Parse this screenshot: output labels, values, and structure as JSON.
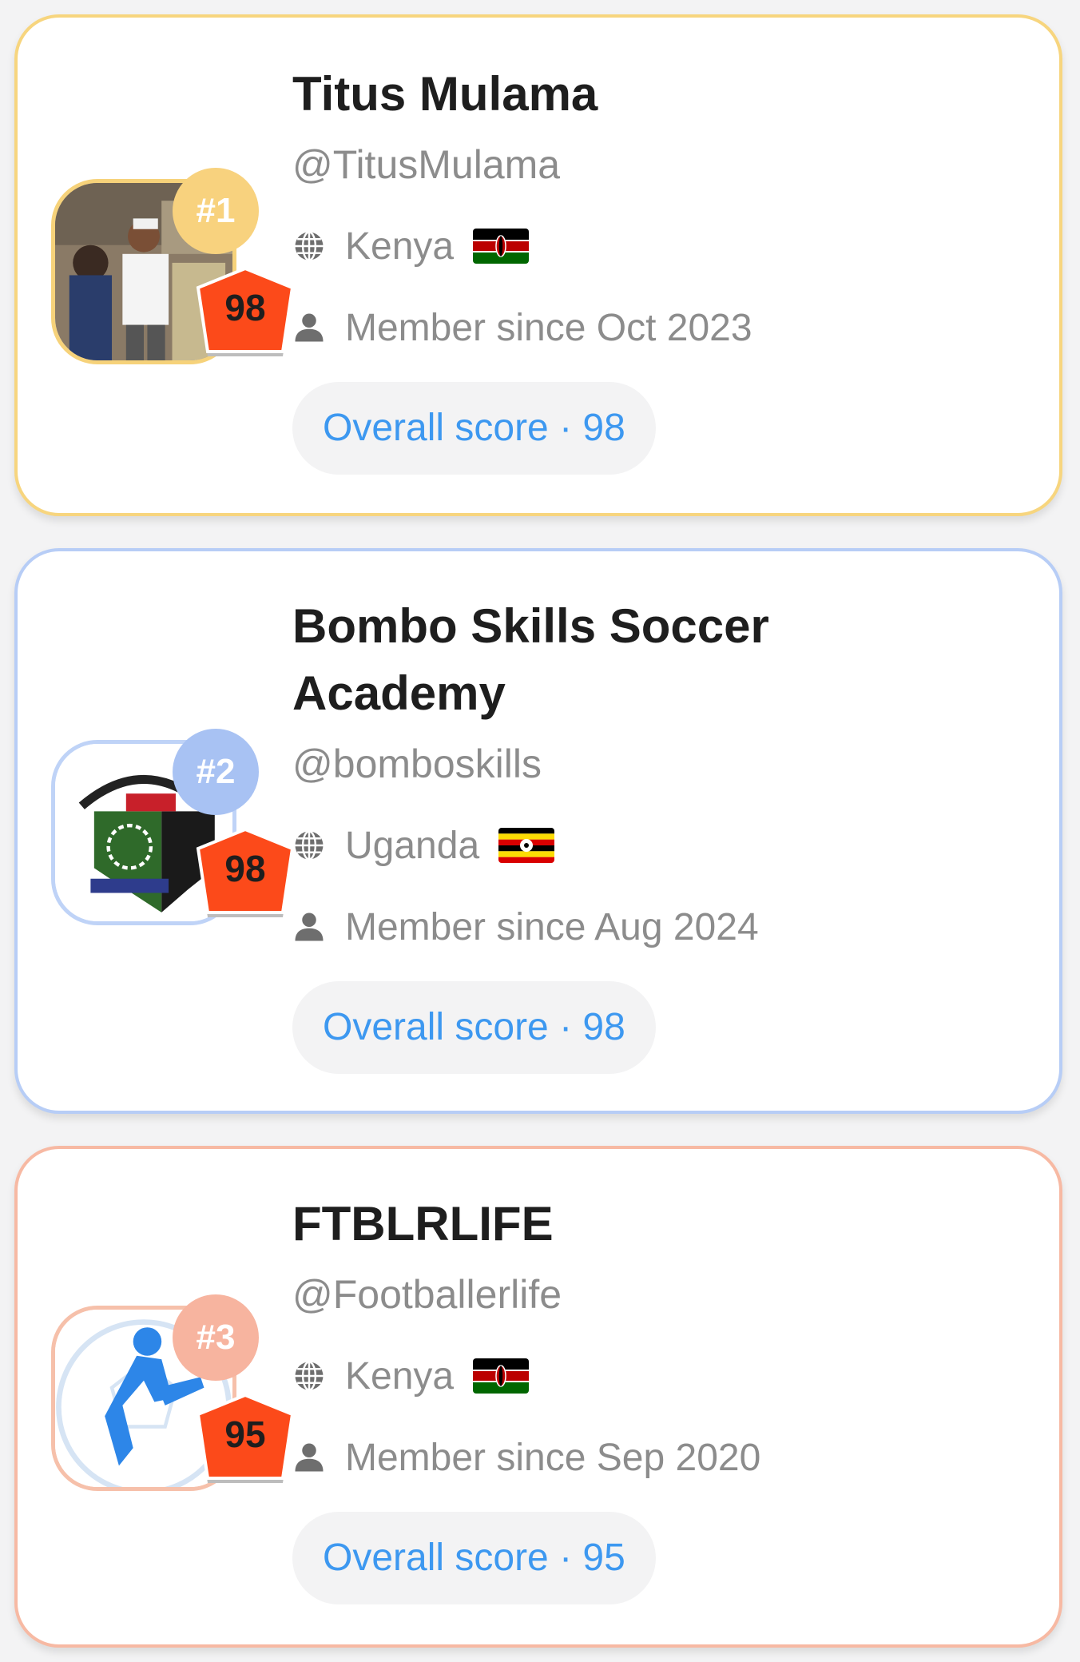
{
  "colors": {
    "gold": "#f7d57e",
    "blue": "#b7cdf6",
    "salmon": "#f7b9a3",
    "score_text": "#3d98f0"
  },
  "cards": [
    {
      "rank": "#1",
      "score": "98",
      "name": "Titus Mulama",
      "handle": "@TitusMulama",
      "country": "Kenya",
      "flag_icon": "kenya-flag-icon",
      "member_since": "Member since Oct 2023",
      "overall_score": "Overall score · 98"
    },
    {
      "rank": "#2",
      "score": "98",
      "name": "Bombo Skills Soccer Academy",
      "handle": "@bomboskills",
      "country": "Uganda",
      "flag_icon": "uganda-flag-icon",
      "member_since": "Member since Aug 2024",
      "overall_score": "Overall score · 98"
    },
    {
      "rank": "#3",
      "score": "95",
      "name": "FTBLRLIFE",
      "handle": "@Footballerlife",
      "country": "Kenya",
      "flag_icon": "kenya-flag-icon",
      "member_since": "Member since Sep 2020",
      "overall_score": "Overall score · 95"
    }
  ]
}
